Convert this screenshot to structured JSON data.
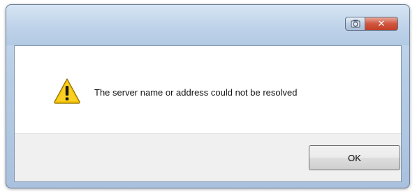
{
  "dialog": {
    "message": "The server name or address could not be resolved",
    "icon": "warning-icon",
    "ok_label": "OK"
  },
  "titlebar": {
    "help_icon": "help-icon",
    "close_label": "✕",
    "close_icon": "close-icon"
  },
  "colors": {
    "close_button": "#c9472f",
    "warning_fill": "#f5c400",
    "titlebar": "#c0d4ea"
  }
}
